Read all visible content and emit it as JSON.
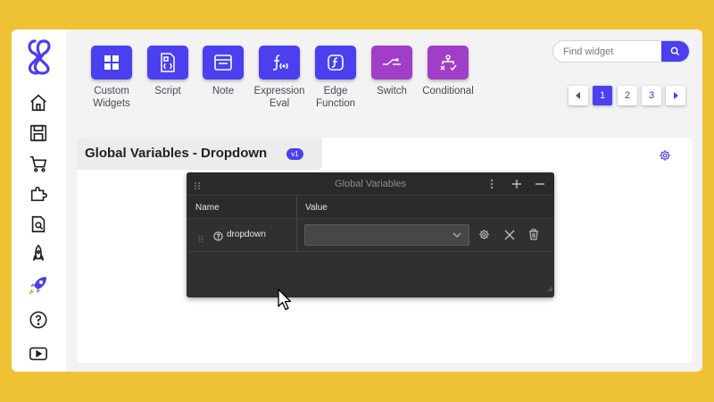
{
  "toolbar": {
    "tools": [
      {
        "label": "Custom Widgets",
        "icon": "grid-icon",
        "color": "#4b3ff0"
      },
      {
        "label": "Script",
        "icon": "script-file-icon",
        "color": "#4b3ff0"
      },
      {
        "label": "Note",
        "icon": "note-icon",
        "color": "#4b3ff0"
      },
      {
        "label": "Expression Eval",
        "icon": "function-icon",
        "color": "#4b3ff0"
      },
      {
        "label": "Edge Function",
        "icon": "edge-function-icon",
        "color": "#4b3ff0"
      },
      {
        "label": "Switch",
        "icon": "switch-icon",
        "color": "#a03ec8"
      },
      {
        "label": "Conditional",
        "icon": "conditional-icon",
        "color": "#a03ec8"
      }
    ]
  },
  "search": {
    "placeholder": "Find widget",
    "value": ""
  },
  "pagination": {
    "pages": [
      "1",
      "2",
      "3"
    ],
    "current": "1"
  },
  "sidebar": {
    "icons": [
      "home-icon",
      "save-icon",
      "cart-icon",
      "puzzle-icon",
      "document-search-icon",
      "rocket-outline-icon",
      "rocket-launch-icon",
      "help-icon",
      "youtube-icon"
    ]
  },
  "panel": {
    "title": "Global Variables - Dropdown",
    "version": "v1"
  },
  "global_vars": {
    "title": "Global Variables",
    "col_name": "Name",
    "col_value": "Value",
    "rows": [
      {
        "name": "dropdown",
        "value": ""
      }
    ]
  },
  "colors": {
    "accent": "#4b3ff0",
    "purple": "#a03ec8",
    "background": "#efc236"
  }
}
